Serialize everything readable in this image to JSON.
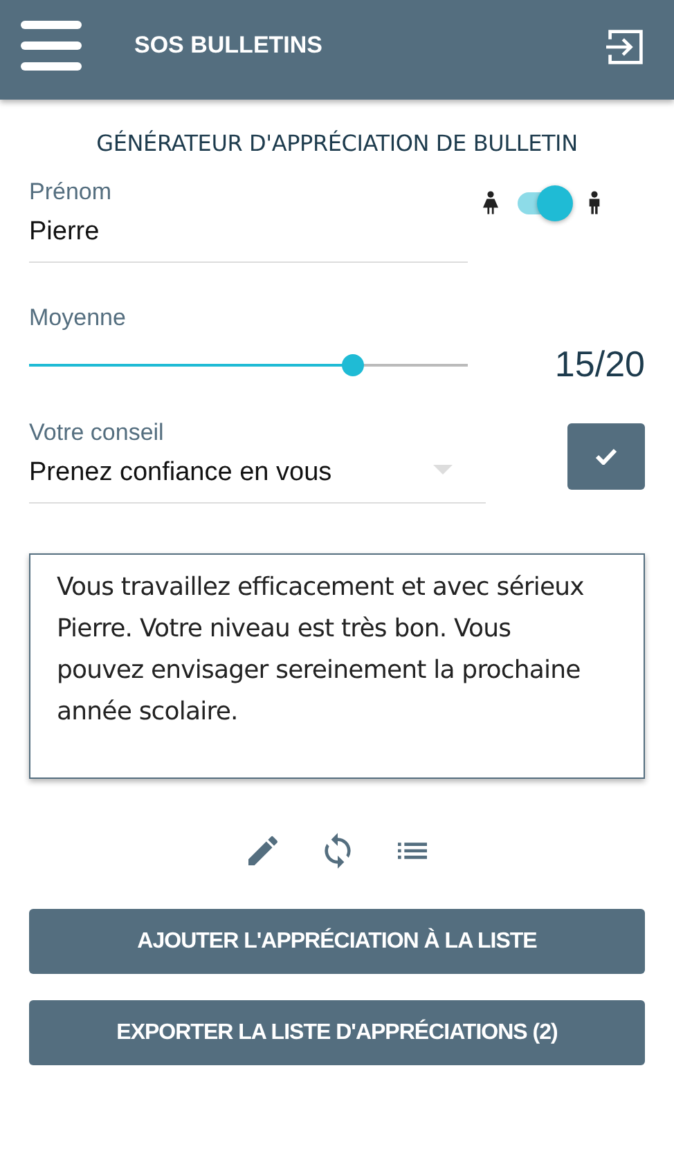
{
  "app_bar": {
    "title": "SOS BULLETINS"
  },
  "heading": "GÉNÉRATEUR D'APPRÉCIATION DE BULLETIN",
  "first_name": {
    "label": "Prénom",
    "value": "Pierre"
  },
  "gender_toggle": {
    "on": true
  },
  "average": {
    "label": "Moyenne",
    "level": 0.75,
    "reading": "15/20"
  },
  "advice": {
    "label": "Votre conseil",
    "value": "Prenez confiance en vous",
    "checked": true
  },
  "appreciation": "Vous travaillez efficacement et avec sérieux Pierre. Votre niveau est très bon. Vous pouvez envisager sereinement la prochaine année scolaire.",
  "buttons": [
    "AJOUTER L'APPRÉCIATION À LA LISTE",
    "EXPORTER LA LISTE D'APPRÉCIATIONS (2)"
  ]
}
